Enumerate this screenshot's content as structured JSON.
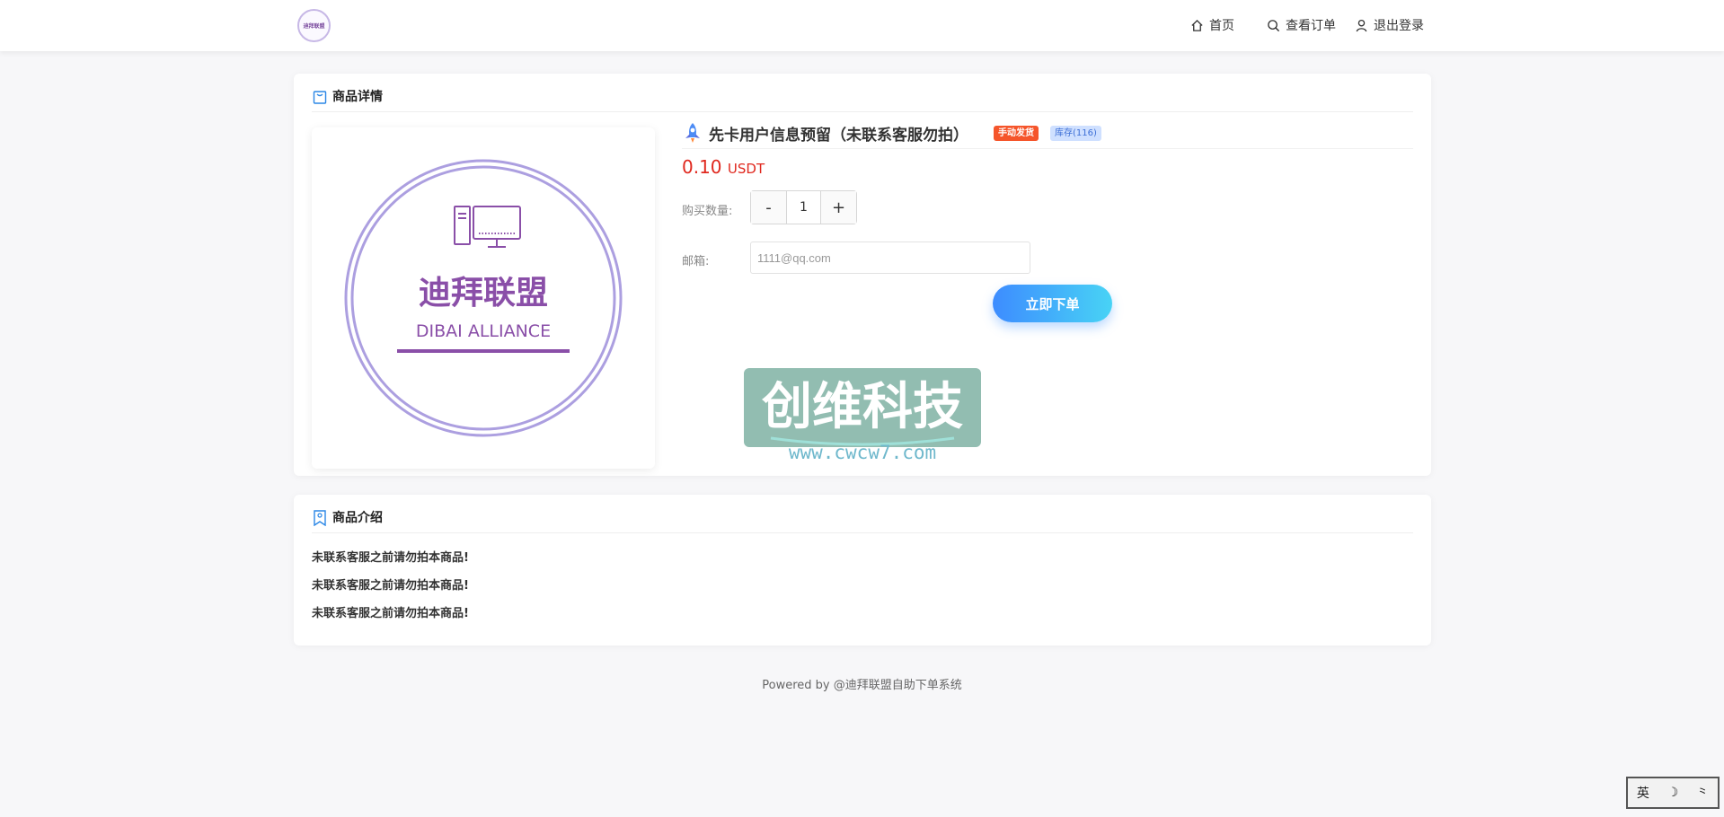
{
  "header": {
    "logo_text": "迪拜联盟",
    "nav": [
      {
        "label": "首页",
        "icon": "home-icon"
      },
      {
        "label": "查看订单",
        "icon": "search-icon"
      },
      {
        "label": "退出登录",
        "icon": "user-icon"
      }
    ]
  },
  "detail": {
    "title": "商品详情",
    "product_image_text_cn": "迪拜联盟",
    "product_image_text_en": "DIBAI ALLIANCE",
    "product_name": "先卡用户信息预留（未联系客服勿拍）",
    "badge_manual": "手动发货",
    "badge_stock": "库存(116)",
    "price": "0.10",
    "currency": "USDT",
    "qty_label": "购买数量:",
    "qty_minus": "-",
    "qty_value": "1",
    "qty_plus": "+",
    "email_label": "邮箱:",
    "email_value": "1111@qq.com",
    "order_button": "立即下单",
    "watermark_cn": "创维科技",
    "watermark_url": "www.cwcw7.com"
  },
  "intro": {
    "title": "商品介绍",
    "lines": [
      "未联系客服之前请勿拍本商品!",
      "未联系客服之前请勿拍本商品!",
      "未联系客服之前请勿拍本商品!"
    ]
  },
  "footer": {
    "text": "Powered by @迪拜联盟自助下单系统"
  },
  "ime": {
    "items": [
      "英",
      "☽",
      "⺀"
    ]
  },
  "colors": {
    "price": "#e0281e",
    "badge_manual": "#f5552b",
    "badge_stock_bg": "#cfe0ff",
    "button_from": "#3d8cff",
    "button_to": "#48d3f5",
    "brand_purple": "#8a4fa8"
  }
}
